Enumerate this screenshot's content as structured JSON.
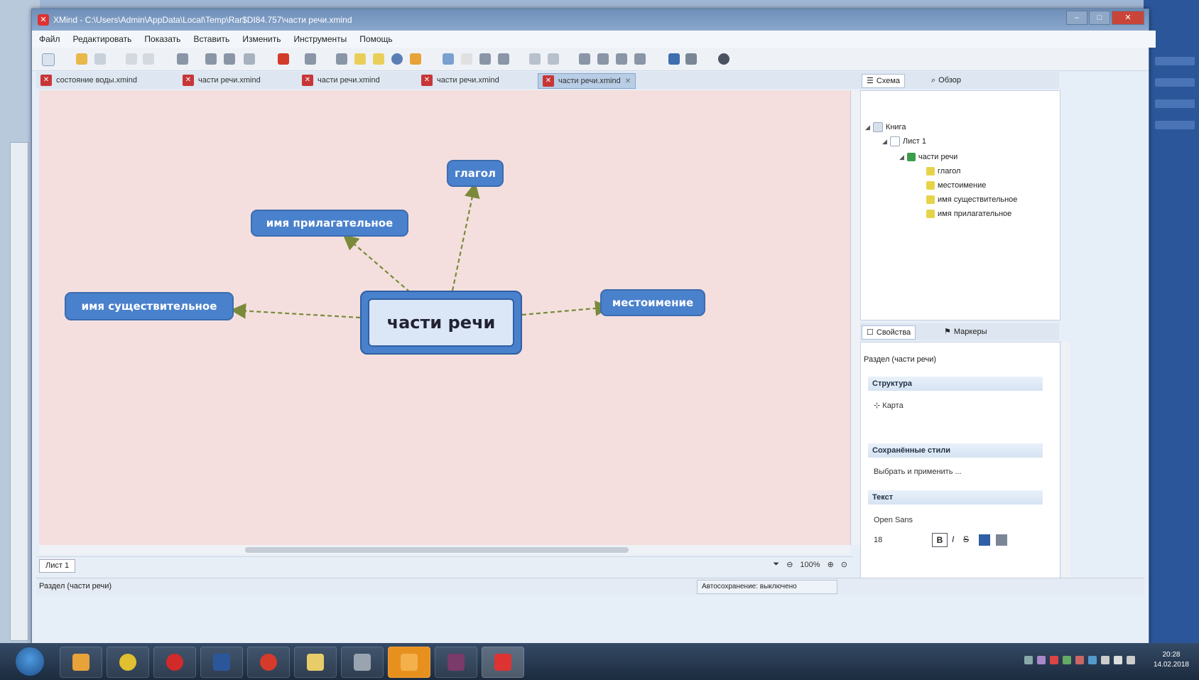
{
  "window": {
    "title": "XMind - C:\\Users\\Admin\\AppData\\Local\\Temp\\Rar$DI84.757\\части речи.xmind"
  },
  "menu": [
    "Файл",
    "Редактировать",
    "Показать",
    "Вставить",
    "Изменить",
    "Инструменты",
    "Помощь"
  ],
  "editor_tabs": [
    {
      "label": "состояние воды.xmind"
    },
    {
      "label": "части речи.xmind"
    },
    {
      "label": "части речи.xmind"
    },
    {
      "label": "части речи.xmind"
    },
    {
      "label": "части речи.xmind"
    }
  ],
  "mindmap": {
    "central": "части речи",
    "topics": {
      "verb": "глагол",
      "adjective": "имя прилагательное",
      "noun": "имя существительное",
      "pronoun": "местоимение"
    }
  },
  "sheet_tab": "Лист 1",
  "zoom": "100%",
  "status": {
    "left": "Раздел (части речи)",
    "right": "Автосохранение: выключено"
  },
  "right_tabs": {
    "outline": "Схема",
    "overview": "Обзор"
  },
  "outline": {
    "workbook": "Книга",
    "sheet": "Лист 1",
    "root": "части речи",
    "topics": [
      "глагол",
      "местоимение",
      "имя существительное",
      "имя прилагательное"
    ]
  },
  "props_tabs": {
    "properties": "Свойства",
    "markers": "Маркеры"
  },
  "properties": {
    "title": "Раздел (части речи)",
    "structure_head": "Структура",
    "structure_value": "Карта",
    "styles_head": "Сохранённые стили",
    "styles_value": "Выбрать и применить ...",
    "text_head": "Текст",
    "font": "Open Sans",
    "size": "18"
  },
  "clock": {
    "time": "20:28",
    "date": "14.02.2018"
  },
  "colors": {
    "topic": "#4a81cc",
    "canvas": "#f4dfde",
    "connector": "#7a8a3a"
  }
}
